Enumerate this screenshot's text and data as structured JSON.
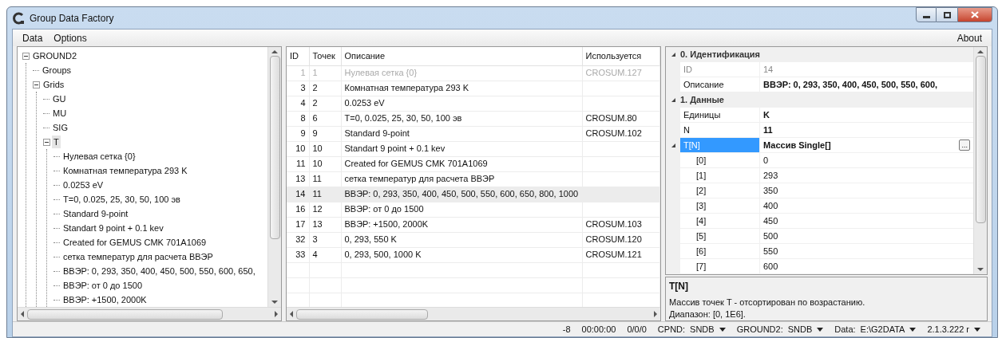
{
  "window": {
    "title": "Group Data Factory"
  },
  "menu": {
    "left": [
      "Data",
      "Options"
    ],
    "right": [
      "About"
    ]
  },
  "tree": [
    {
      "label": "GROUND2",
      "expanded": true,
      "selected": false,
      "children": [
        {
          "label": "Groups",
          "selected": false
        },
        {
          "label": "Grids",
          "expanded": true,
          "selected": false,
          "children": [
            {
              "label": "GU",
              "selected": false
            },
            {
              "label": "MU",
              "selected": false
            },
            {
              "label": "SIG",
              "selected": false
            },
            {
              "label": "T",
              "expanded": true,
              "selected": true,
              "children": [
                {
                  "label": "Нулевая сетка {0}",
                  "selected": false
                },
                {
                  "label": "Комнатная температура 293 K",
                  "selected": false
                },
                {
                  "label": "0.0253 eV",
                  "selected": false
                },
                {
                  "label": "T=0, 0.025, 25, 30, 50, 100 эв",
                  "selected": false
                },
                {
                  "label": "Standard 9-point",
                  "selected": false
                },
                {
                  "label": "Standart 9 point + 0.1 kev",
                  "selected": false
                },
                {
                  "label": "Created for GEMUS CMK 701A1069",
                  "selected": false
                },
                {
                  "label": "сетка температур для расчета ВВЭР",
                  "selected": false
                },
                {
                  "label": "ВВЭР: 0, 293, 350, 400, 450, 500, 550, 600, 650,",
                  "selected": false
                },
                {
                  "label": "ВВЭР: от 0 до 1500",
                  "selected": false
                },
                {
                  "label": "ВВЭР: +1500, 2000K",
                  "selected": false
                }
              ]
            }
          ]
        }
      ]
    }
  ],
  "table": {
    "columns": [
      "ID",
      "Точек",
      "Описание",
      "Используется"
    ],
    "rows": [
      {
        "cells": [
          "1",
          "1",
          "Нулевая сетка {0}",
          "CROSUM.127"
        ],
        "disabled": true,
        "selected": false
      },
      {
        "cells": [
          "3",
          "2",
          "Комнатная температура 293 K",
          ""
        ],
        "disabled": false,
        "selected": false
      },
      {
        "cells": [
          "4",
          "2",
          "0.0253 eV",
          ""
        ],
        "disabled": false,
        "selected": false
      },
      {
        "cells": [
          "8",
          "6",
          "T=0, 0.025, 25, 30, 50, 100 эв",
          "CROSUM.80"
        ],
        "disabled": false,
        "selected": false
      },
      {
        "cells": [
          "9",
          "9",
          "Standard 9-point",
          "CROSUM.102"
        ],
        "disabled": false,
        "selected": false
      },
      {
        "cells": [
          "10",
          "10",
          "Standart 9 point + 0.1 kev",
          ""
        ],
        "disabled": false,
        "selected": false
      },
      {
        "cells": [
          "11",
          "10",
          "Created for GEMUS CMK 701A1069",
          ""
        ],
        "disabled": false,
        "selected": false
      },
      {
        "cells": [
          "13",
          "11",
          "сетка температур для расчета ВВЭР",
          ""
        ],
        "disabled": false,
        "selected": false
      },
      {
        "cells": [
          "14",
          "11",
          "ВВЭР: 0, 293, 350, 400, 450, 500, 550, 600, 650, 800, 1000",
          ""
        ],
        "disabled": false,
        "selected": true
      },
      {
        "cells": [
          "16",
          "12",
          "ВВЭР: от 0 до 1500",
          ""
        ],
        "disabled": false,
        "selected": false
      },
      {
        "cells": [
          "17",
          "13",
          "ВВЭР: +1500, 2000K",
          "CROSUM.103"
        ],
        "disabled": false,
        "selected": false
      },
      {
        "cells": [
          "32",
          "3",
          "0, 293, 550 K",
          "CROSUM.120"
        ],
        "disabled": false,
        "selected": false
      },
      {
        "cells": [
          "33",
          "4",
          "0, 293, 500, 1000 K",
          "CROSUM.121"
        ],
        "disabled": false,
        "selected": false
      }
    ]
  },
  "properties": {
    "categories": [
      {
        "title": "0. Идентификация",
        "expanded": true,
        "rows": [
          {
            "name": "ID",
            "value": "14",
            "readonly": true,
            "bold": false,
            "selected": false
          },
          {
            "name": "Описание",
            "value": "ВВЭР: 0, 293, 350, 400, 450, 500, 550, 600,",
            "readonly": false,
            "bold": true,
            "selected": false
          }
        ]
      },
      {
        "title": "1. Данные",
        "expanded": true,
        "rows": [
          {
            "name": "Единицы",
            "value": "K",
            "readonly": false,
            "bold": true,
            "selected": false
          },
          {
            "name": "N",
            "value": "11",
            "readonly": false,
            "bold": true,
            "selected": false
          },
          {
            "name": "T[N]",
            "value": "Массив Single[]",
            "readonly": false,
            "bold": true,
            "selected": true,
            "expanded": true,
            "button": "...",
            "children": [
              {
                "name": "[0]",
                "value": "0"
              },
              {
                "name": "[1]",
                "value": "293"
              },
              {
                "name": "[2]",
                "value": "350"
              },
              {
                "name": "[3]",
                "value": "400"
              },
              {
                "name": "[4]",
                "value": "450"
              },
              {
                "name": "[5]",
                "value": "500"
              },
              {
                "name": "[6]",
                "value": "550"
              },
              {
                "name": "[7]",
                "value": "600"
              }
            ]
          }
        ]
      }
    ],
    "description": {
      "title": "T[N]",
      "lines": [
        "Массив точек T - отсортирован по возрастанию.",
        "Диапазон: [0, 1E6]."
      ]
    }
  },
  "status_bar": [
    {
      "kind": "text",
      "text": "-8"
    },
    {
      "kind": "text",
      "text": "00:00:00"
    },
    {
      "kind": "text",
      "text": "0/0/0"
    },
    {
      "kind": "dropdown",
      "label": "CPND:",
      "text": "SNDB"
    },
    {
      "kind": "dropdown",
      "label": "GROUND2:",
      "text": "SNDB"
    },
    {
      "kind": "dropdown",
      "label": "Data:",
      "text": "E:\\G2DATA"
    },
    {
      "kind": "dropdown",
      "text": "2.1.3.222 r"
    }
  ]
}
